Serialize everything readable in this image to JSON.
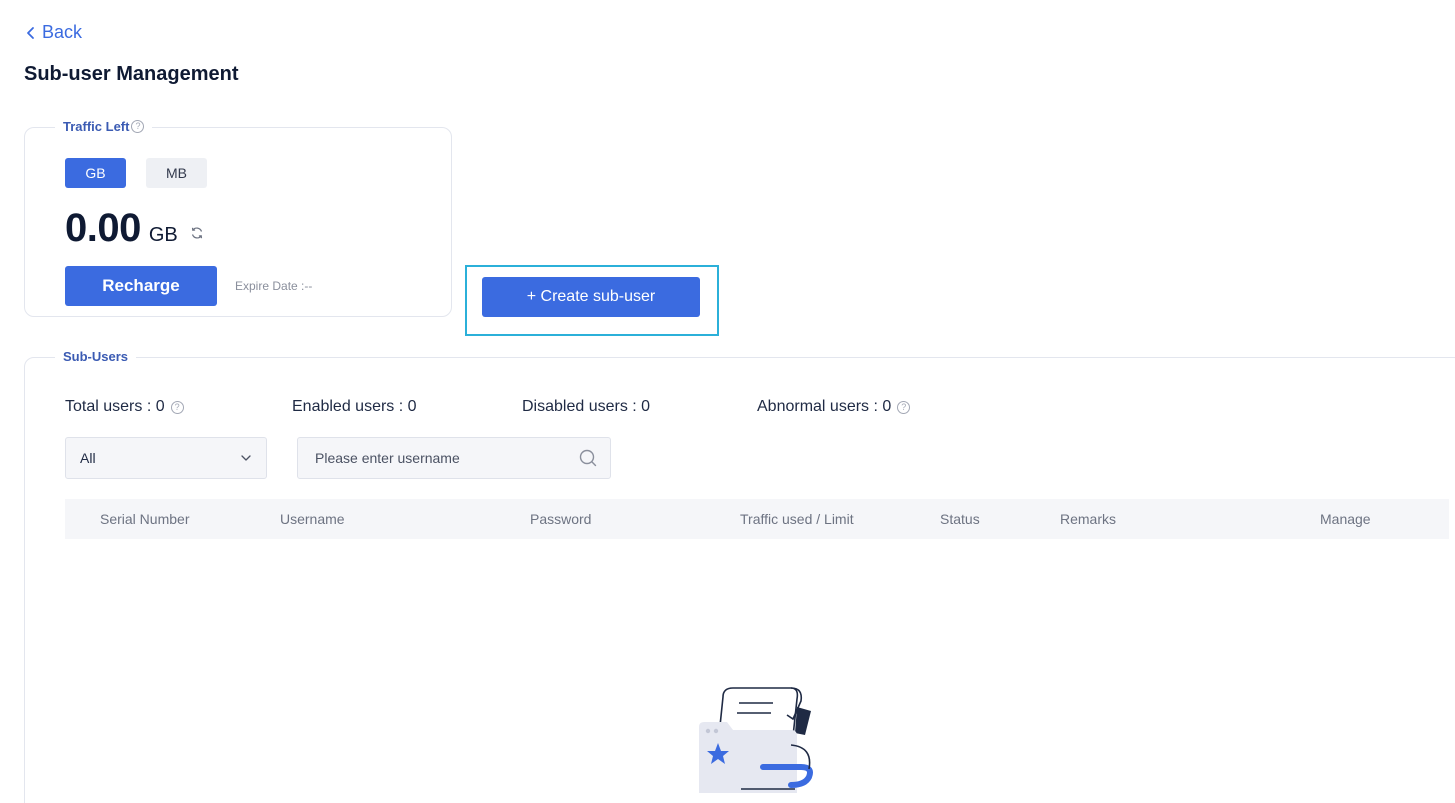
{
  "nav": {
    "back_label": "Back"
  },
  "page": {
    "title": "Sub-user Management"
  },
  "traffic": {
    "legend": "Traffic Left",
    "units": [
      {
        "label": "GB",
        "active": true
      },
      {
        "label": "MB",
        "active": false
      }
    ],
    "value": "0.00",
    "unit": "GB",
    "recharge_label": "Recharge",
    "expire_text": "Expire Date :--"
  },
  "actions": {
    "create_label": "+ Create sub-user"
  },
  "subusers": {
    "legend": "Sub-Users",
    "stats": {
      "total": "Total users : 0",
      "enabled": "Enabled users : 0",
      "disabled": "Disabled users : 0",
      "abnormal": "Abnormal users : 0"
    },
    "filter": {
      "selected": "All"
    },
    "search": {
      "placeholder": "Please enter username",
      "value": ""
    },
    "columns": [
      "Serial Number",
      "Username",
      "Password",
      "Traffic used / Limit",
      "Status",
      "Remarks",
      "Manage"
    ]
  },
  "colors": {
    "primary": "#3b6be0",
    "highlight": "#2bb0d9",
    "title": "#0f1a33",
    "legend": "#3b5bb3"
  }
}
